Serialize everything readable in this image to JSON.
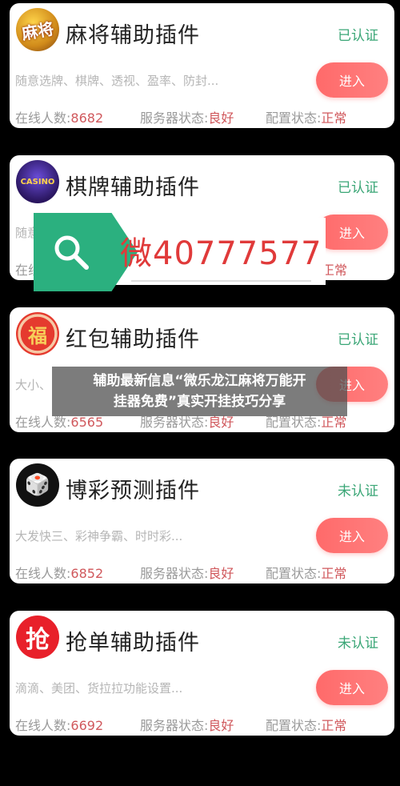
{
  "cards": [
    {
      "title": "麻将辅助插件",
      "status": "已认证",
      "status_color": "#3aa676",
      "desc": "随意选牌、棋牌、透视、盈率、防封...",
      "button": "进入",
      "online_label": "在线人数:",
      "online_value": "8682",
      "server_label": "服务器状态:",
      "server_value": "良好",
      "config_label": "配置状态:",
      "config_value": "正常",
      "logo_text": "麻将"
    },
    {
      "title": "棋牌辅助插件",
      "status": "已认证",
      "status_color": "#3aa676",
      "desc": "随意",
      "button": "进入",
      "online_label": "在线",
      "online_value": "",
      "server_label": "",
      "server_value": "",
      "config_label": "",
      "config_value": "正常",
      "logo_text": "CASINO"
    },
    {
      "title": "红包辅助插件",
      "status": "已认证",
      "status_color": "#3aa676",
      "desc": "大小、",
      "button": "进入",
      "online_label": "在线人数:",
      "online_value": "6565",
      "server_label": "服务器状态:",
      "server_value": "良好",
      "config_label": "配置状态:",
      "config_value": "正常",
      "logo_text": "福"
    },
    {
      "title": "博彩预测插件",
      "status": "未认证",
      "status_color": "#3aa676",
      "desc": "大发快三、彩神争霸、时时彩...",
      "button": "进入",
      "online_label": "在线人数:",
      "online_value": "6852",
      "server_label": "服务器状态:",
      "server_value": "良好",
      "config_label": "配置状态:",
      "config_value": "正常",
      "logo_text": "🎲"
    },
    {
      "title": "抢单辅助插件",
      "status": "未认证",
      "status_color": "#3aa676",
      "desc": "滴滴、美团、货拉拉功能设置...",
      "button": "进入",
      "online_label": "在线人数:",
      "online_value": "6692",
      "server_label": "服务器状态:",
      "server_value": "良好",
      "config_label": "配置状态:",
      "config_value": "正常",
      "logo_text": "抢"
    }
  ],
  "search_banner": {
    "text": "微40777577",
    "icon": "search-icon",
    "color": "#2bb07f"
  },
  "headline": {
    "line1": "辅助最新信息“微乐龙江麻将万能开",
    "line2": "挂器免费”真实开挂技巧分享"
  }
}
